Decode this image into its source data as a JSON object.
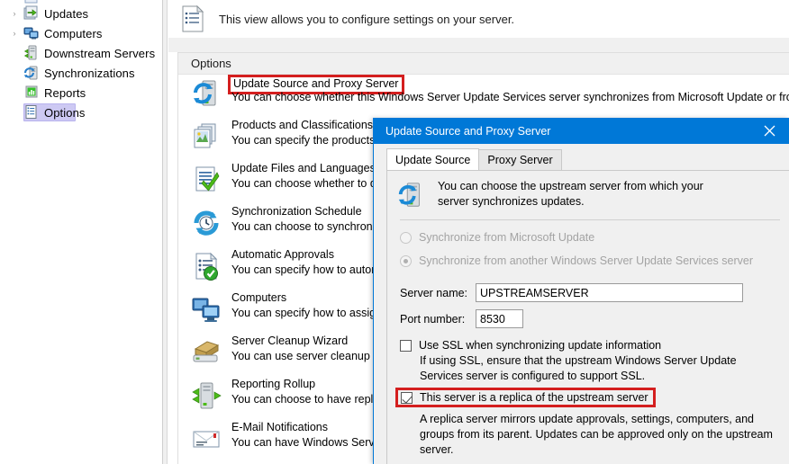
{
  "tree": {
    "items": [
      {
        "label": "Updates",
        "icon": "updates-icon",
        "expander": "›",
        "selected": false
      },
      {
        "label": "Computers",
        "icon": "computers-icon",
        "expander": "›",
        "selected": false
      },
      {
        "label": "Downstream Servers",
        "icon": "downstream-servers-icon",
        "expander": "",
        "selected": false
      },
      {
        "label": "Synchronizations",
        "icon": "synchronizations-icon",
        "expander": "",
        "selected": false
      },
      {
        "label": "Reports",
        "icon": "reports-icon",
        "expander": "",
        "selected": false
      },
      {
        "label": "Options",
        "icon": "options-icon",
        "expander": "",
        "selected": true
      }
    ]
  },
  "banner": {
    "icon": "options-list-icon",
    "text": "This view allows you to configure settings on your server."
  },
  "options_panel": {
    "header": "Options",
    "rows": [
      {
        "title": "Update Source and Proxy Server",
        "desc": "You can choose whether this Windows Server Update Services server synchronizes from Microsoft Update or from an up",
        "icon": "update-source-icon",
        "highlighted": true
      },
      {
        "title": "Products and Classifications",
        "desc": "You can specify the products fo",
        "icon": "products-classifications-icon",
        "highlighted": false
      },
      {
        "title": "Update Files and Languages",
        "desc": "You can choose whether to dov",
        "icon": "update-files-languages-icon",
        "highlighted": false
      },
      {
        "title": "Synchronization Schedule",
        "desc": "You can choose to synchronize",
        "icon": "synchronization-schedule-icon",
        "highlighted": false
      },
      {
        "title": "Automatic Approvals",
        "desc": "You can specify how to automa",
        "icon": "automatic-approvals-icon",
        "highlighted": false
      },
      {
        "title": "Computers",
        "desc": "You can specify how to assign",
        "icon": "computers-option-icon",
        "highlighted": false
      },
      {
        "title": "Server Cleanup Wizard",
        "desc": "You can use server cleanup to f",
        "icon": "server-cleanup-icon",
        "highlighted": false
      },
      {
        "title": "Reporting Rollup",
        "desc": "You can choose to have replica",
        "icon": "reporting-rollup-icon",
        "highlighted": false
      },
      {
        "title": "E-Mail Notifications",
        "desc": "You can have Windows Server",
        "icon": "email-notifications-icon",
        "highlighted": false
      }
    ]
  },
  "dialog": {
    "title": "Update Source and Proxy Server",
    "close_icon": "close-icon",
    "tabs": [
      {
        "label": "Update Source",
        "active": true
      },
      {
        "label": "Proxy Server",
        "active": false
      }
    ],
    "header_icon": "update-source-icon",
    "header_text": "You can choose the upstream server from which your server synchronizes updates.",
    "radios": [
      {
        "label": "Synchronize from Microsoft Update",
        "checked": false,
        "disabled": true
      },
      {
        "label": "Synchronize from another Windows Server Update Services server",
        "checked": true,
        "disabled": true
      }
    ],
    "server_name_label": "Server name:",
    "server_name_value": "UPSTREAMSERVER",
    "port_label": "Port number:",
    "port_value": "8530",
    "ssl_checkbox_label": "Use SSL when synchronizing update information",
    "ssl_checked": false,
    "ssl_note": "If using SSL, ensure that the upstream Windows Server Update Services server is configured to support SSL.",
    "replica_checkbox_label": "This server is a replica of the upstream server",
    "replica_checked": true,
    "replica_highlighted": true,
    "replica_note": "A replica server mirrors update approvals, settings, computers, and groups from its parent. Updates can be approved only on the upstream server."
  },
  "colors": {
    "accent": "#0078d7",
    "highlight": "#d41f1f",
    "panel": "#f0f0f0",
    "selection": "#cdc9f3"
  }
}
